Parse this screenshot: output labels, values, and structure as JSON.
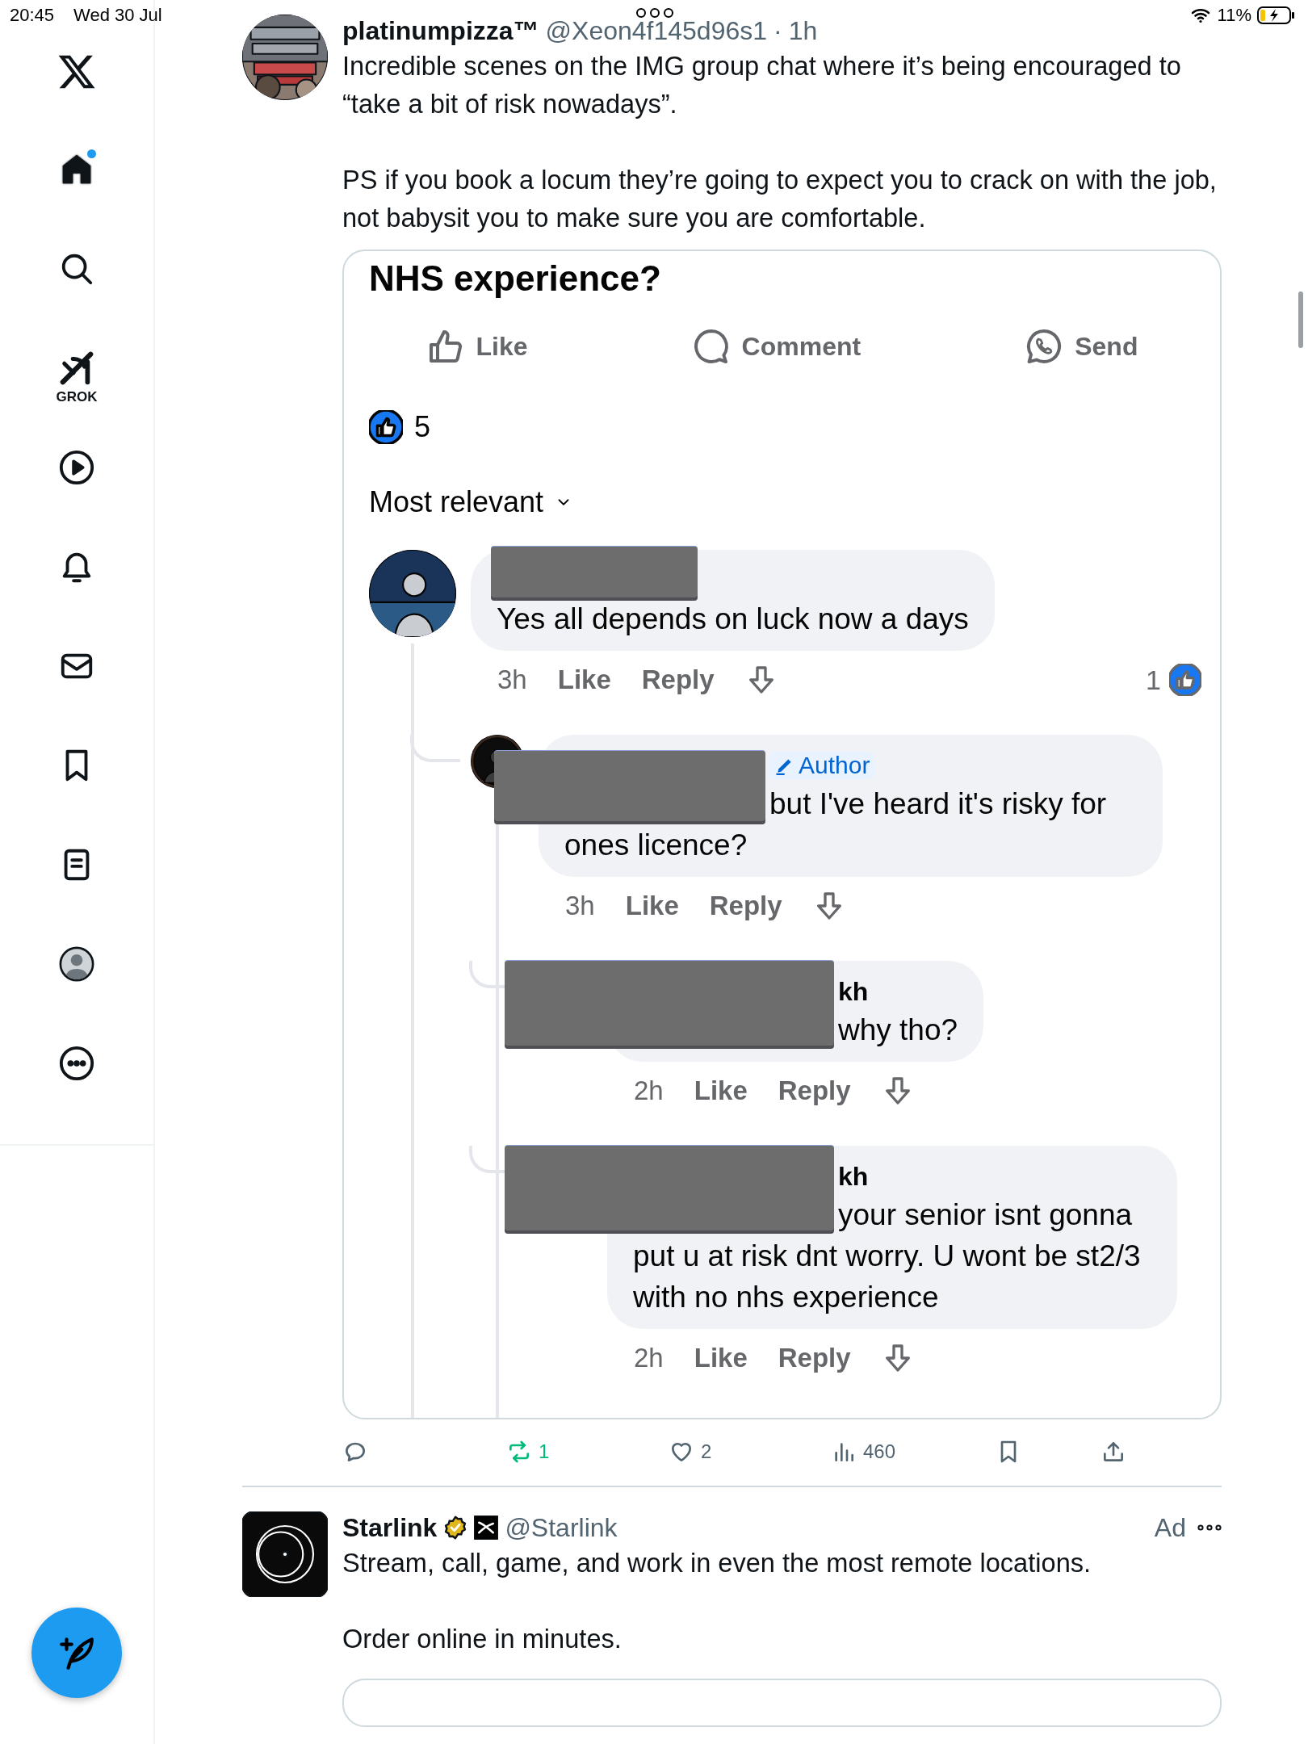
{
  "status_bar": {
    "time": "20:45",
    "date": "Wed 30 Jul",
    "battery": "11%",
    "charging": true
  },
  "sidebar": {
    "items": [
      {
        "kind": "logo"
      },
      {
        "kind": "home",
        "selected": true,
        "dot": true
      },
      {
        "kind": "search",
        "selected": false
      },
      {
        "kind": "grok",
        "label": "GROK",
        "selected": false
      },
      {
        "kind": "video",
        "selected": false
      },
      {
        "kind": "notifications",
        "selected": false
      },
      {
        "kind": "messages",
        "selected": false
      },
      {
        "kind": "bookmarks",
        "selected": false
      },
      {
        "kind": "articles",
        "selected": false
      },
      {
        "kind": "profile",
        "selected": false
      },
      {
        "kind": "more",
        "selected": false
      }
    ]
  },
  "post": {
    "author": "platinumpizza™",
    "handle": "@Xeon4f145d96s1",
    "separator": "·",
    "time": "1h",
    "paragraphs": [
      "Incredible scenes on the IMG group chat where it’s being encouraged to “take a bit of risk nowadays”.",
      "PS if you book a locum they’re going to expect you to crack on with the job, not babysit you to make sure you are comfortable."
    ],
    "screenshot": {
      "title": "NHS experience?",
      "buttons": [
        {
          "kind": "like",
          "label": "Like"
        },
        {
          "kind": "comment",
          "label": "Comment"
        },
        {
          "kind": "send",
          "label": "Send"
        }
      ],
      "reaction_count": "5",
      "sort": "Most relevant",
      "comments": [
        {
          "redacted": true,
          "text": "Yes all depends on luck now a days",
          "time": "3h",
          "like": "Like",
          "reply": "Reply",
          "reactions": "1",
          "children": [
            {
              "redacted": true,
              "badge": "Author",
              "text": "but I've heard it's risky for ones licence?",
              "time": "3h",
              "like": "Like",
              "reply": "Reply",
              "children": [
                {
                  "redacted": true,
                  "name": "kh",
                  "text": "why tho?",
                  "time": "2h",
                  "like": "Like",
                  "reply": "Reply"
                },
                {
                  "redacted": true,
                  "name": "kh",
                  "text": "your senior isnt gonna put u at risk dnt worry. U wont be st2/3 with no nhs experience",
                  "time": "2h",
                  "like": "Like",
                  "reply": "Reply"
                }
              ]
            }
          ]
        }
      ]
    },
    "actions": [
      {
        "kind": "reply",
        "active": false
      },
      {
        "kind": "repost",
        "count": "1",
        "active": true
      },
      {
        "kind": "like",
        "count": "2",
        "active": false
      },
      {
        "kind": "views",
        "count": "460",
        "active": false
      },
      {
        "kind": "bookmark",
        "active": false
      },
      {
        "kind": "share",
        "active": false
      }
    ]
  },
  "ad": {
    "name": "Starlink",
    "verified": true,
    "affiliate": true,
    "handle": "@Starlink",
    "label": "Ad",
    "paragraphs": [
      "Stream, call, game, and work in even the most remote locations.",
      "Order online in minutes."
    ]
  }
}
